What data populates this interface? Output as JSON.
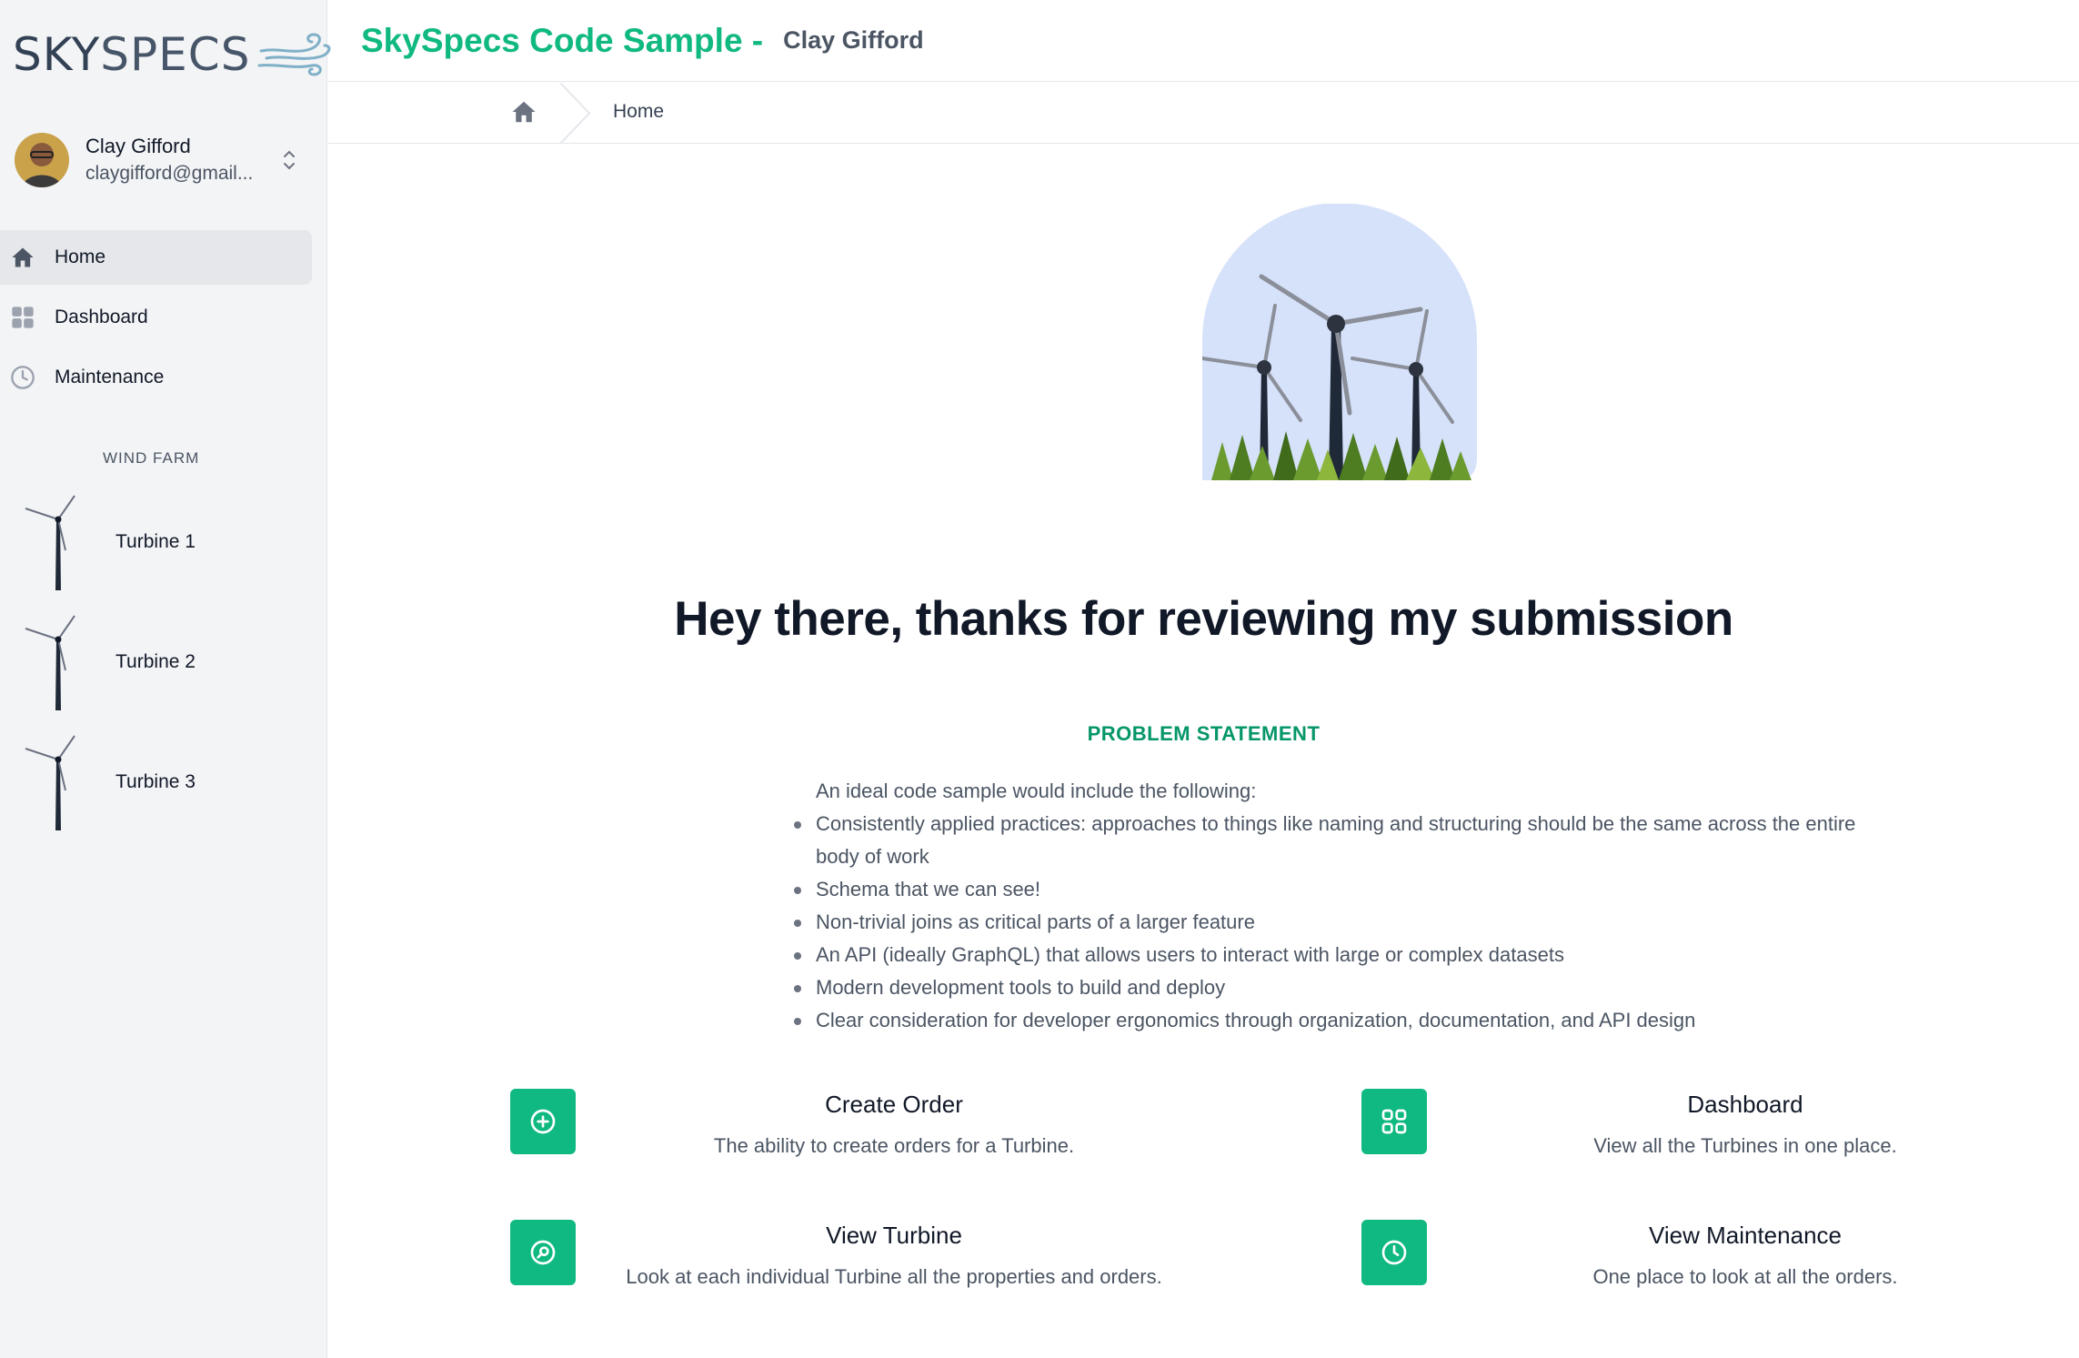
{
  "brand": {
    "logo_part1": "SKY",
    "logo_part2": "SPECS"
  },
  "user": {
    "name": "Clay Gifford",
    "email": "claygifford@gmail..."
  },
  "nav": [
    {
      "label": "Home",
      "icon": "home-icon",
      "active": true
    },
    {
      "label": "Dashboard",
      "icon": "grid-icon",
      "active": false
    },
    {
      "label": "Maintenance",
      "icon": "clock-icon",
      "active": false
    }
  ],
  "wind_farm": {
    "title": "WIND FARM",
    "turbines": [
      "Turbine 1",
      "Turbine 2",
      "Turbine 3"
    ]
  },
  "header": {
    "title": "SkySpecs Code Sample -",
    "subtitle": "Clay Gifford"
  },
  "breadcrumb": {
    "current": "Home"
  },
  "main": {
    "heading": "Hey there, thanks for reviewing my submission",
    "problem_title": "PROBLEM STATEMENT",
    "problem_intro": "An ideal code sample would include the following:",
    "problem_items": [
      "Consistently applied practices: approaches to things like naming and structuring should be the same across the entire body of work",
      "Schema that we can see!",
      "Non-trivial joins as critical parts of a larger feature",
      "An API (ideally GraphQL) that allows users to interact with large or complex datasets",
      "Modern development tools to build and deploy",
      "Clear consideration for developer ergonomics through organization, documentation, and API design"
    ],
    "features": [
      {
        "title": "Create Order",
        "desc": "The ability to create orders for a Turbine.",
        "icon": "plus-circle-icon"
      },
      {
        "title": "Dashboard",
        "desc": "View all the Turbines in one place.",
        "icon": "grid-icon"
      },
      {
        "title": "View Turbine",
        "desc": "Look at each individual Turbine all the properties and orders.",
        "icon": "search-circle-icon"
      },
      {
        "title": "View Maintenance",
        "desc": "One place to look at all the orders.",
        "icon": "clock-icon"
      }
    ]
  },
  "colors": {
    "accent": "#10b981",
    "accent_dark": "#059669",
    "sidebar_bg": "#f3f4f6"
  }
}
